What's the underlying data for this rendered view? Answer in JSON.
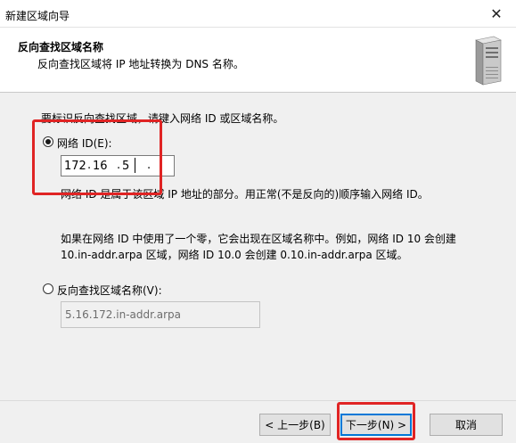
{
  "window": {
    "title": "新建区域向导"
  },
  "header": {
    "title": "反向查找区域名称",
    "subtitle": "反向查找区域将 IP 地址转换为 DNS 名称。",
    "icon": "server-icon"
  },
  "main": {
    "instruction": "要标识反向查找区域，请键入网络 ID 或区域名称。",
    "network_id": {
      "label": "网络 ID(E):",
      "selected": true,
      "octets": [
        "172",
        "16",
        "5",
        ""
      ]
    },
    "desc1": "网络 ID 是属于该区域 IP 地址的部分。用正常(不是反向的)顺序输入网络 ID。",
    "desc2_line1": "如果在网络 ID 中使用了一个零，它会出现在区域名称中。例如，网络 ID 10 会创建",
    "desc2_line2": "10.in-addr.arpa 区域，网络 ID 10.0 会创建 0.10.in-addr.arpa 区域。",
    "zone_name": {
      "label": "反向查找区域名称(V):",
      "selected": false,
      "value": "5.16.172.in-addr.arpa"
    }
  },
  "buttons": {
    "back": "< 上一步(B)",
    "next": "下一步(N) >",
    "cancel": "取消"
  },
  "colors": {
    "annotation": "#e02424",
    "focus": "#0078d7"
  }
}
